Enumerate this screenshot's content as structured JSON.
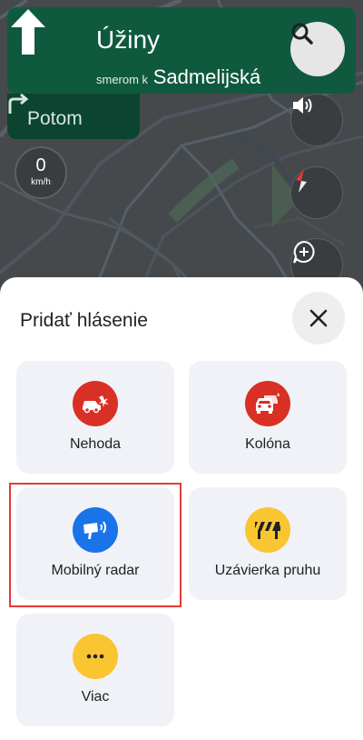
{
  "navigation": {
    "street": "Úžiny",
    "toward_prefix": "smerom k",
    "toward_street": "Sadmelijská",
    "then_label": "Potom"
  },
  "speedometer": {
    "value": "0",
    "unit": "km/h"
  },
  "map_controls": [
    {
      "name": "search-icon"
    },
    {
      "name": "volume-icon"
    },
    {
      "name": "compass-icon"
    },
    {
      "name": "add-report-icon"
    }
  ],
  "sheet": {
    "title": "Pridať hlásenie",
    "close_icon": "close-icon",
    "options": [
      {
        "label": "Nehoda",
        "icon": "crash-icon",
        "color": "#d93025"
      },
      {
        "label": "Kolóna",
        "icon": "traffic-jam-icon",
        "color": "#d93025"
      },
      {
        "label": "Mobilný radar",
        "icon": "speed-camera-icon",
        "color": "#1a73e8"
      },
      {
        "label": "Uzávierka pruhu",
        "icon": "lane-closure-icon",
        "color": "#f9c531"
      },
      {
        "label": "Viac",
        "icon": "more-icon",
        "color": "#f9c531"
      }
    ]
  },
  "colors": {
    "nav_green": "#0f5a3e",
    "nav_dark_green": "#0b4430",
    "map_background": "#46494b",
    "highlight_red": "#e53935"
  }
}
